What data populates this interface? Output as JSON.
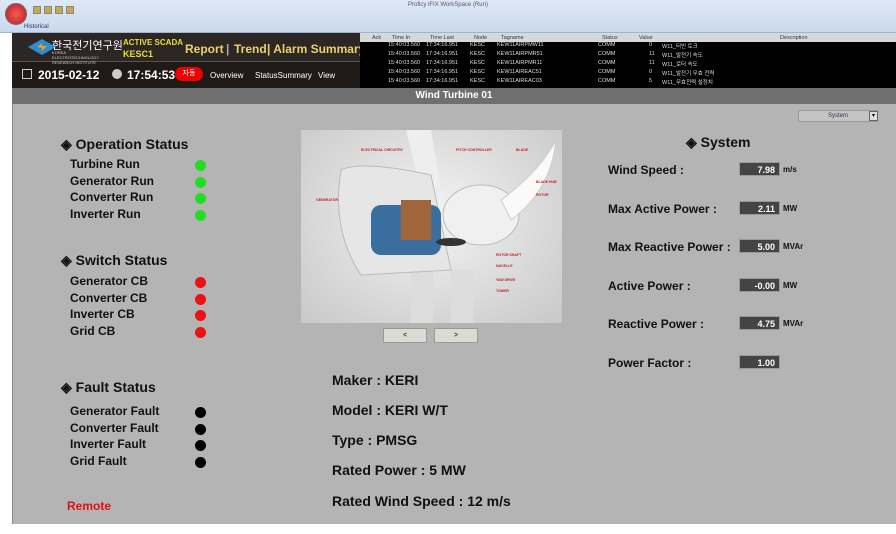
{
  "window": {
    "title": "Proficy iFIX WorkSpace (Run)",
    "ribbon_tab": "Historical"
  },
  "header": {
    "org_korean": "한국전기연구원",
    "org_english": "KOREA ELECTROTECHNOLOGY RESEARCH INSTITUTE",
    "system": "ACTIVE SCADA",
    "station": "KESC1",
    "nav": [
      "Report",
      "|",
      "Trend",
      "| Alarm Summary"
    ],
    "date": "2015-02-12",
    "time": "17:54:53",
    "mode_badge": "자동",
    "subnav": [
      "Overview",
      "StatusSummary",
      "View"
    ]
  },
  "alarms": {
    "columns": [
      "Ack",
      "Time In",
      "Time Last",
      "Node",
      "Tagname",
      "Status",
      "Value",
      "Description"
    ],
    "rows": [
      [
        "",
        "15:40:03.560",
        "17:34:16.951",
        "KESC",
        "KEW11AIRPMW11",
        "COMM",
        "0",
        "W11_터빈 토크"
      ],
      [
        "",
        "15:40:03.560",
        "17:34:16.951",
        "KESC",
        "KEW11AIRPMR51",
        "COMM",
        "11",
        "W11_발전기 속도"
      ],
      [
        "",
        "15:40:03.560",
        "17:34:16.951",
        "KESC",
        "KEW11AIRPMR11",
        "COMM",
        "11",
        "W11_로터 속도"
      ],
      [
        "",
        "15:40:03.560",
        "17:34:16.951",
        "KESC",
        "KEW11AIREAC51",
        "COMM",
        "0",
        "W11_발전기 무효 전력"
      ],
      [
        "",
        "15:40:03.560",
        "17:34:16.951",
        "KESC",
        "KEW11AIREAC03",
        "COMM",
        "5",
        "W11_무효전력 설정치"
      ]
    ]
  },
  "page_title": "Wind Turbine 01",
  "operation": {
    "title": "◈ Operation Status",
    "items": [
      {
        "label": "Turbine Run",
        "color": "#22dd22"
      },
      {
        "label": "Generator Run",
        "color": "#22dd22"
      },
      {
        "label": "Converter Run",
        "color": "#22dd22"
      },
      {
        "label": "Inverter Run",
        "color": "#22dd22"
      }
    ]
  },
  "switch": {
    "title": "◈ Switch Status",
    "items": [
      {
        "label": "Generator CB",
        "color": "#ee1111"
      },
      {
        "label": "Converter CB",
        "color": "#ee1111"
      },
      {
        "label": "Inverter CB",
        "color": "#ee1111"
      },
      {
        "label": "Grid CB",
        "color": "#ee1111"
      }
    ]
  },
  "fault": {
    "title": "◈ Fault Status",
    "items": [
      {
        "label": "Generator Fault",
        "color": "#000000"
      },
      {
        "label": "Converter Fault",
        "color": "#000000"
      },
      {
        "label": "Inverter Fault",
        "color": "#000000"
      },
      {
        "label": "Grid Fault",
        "color": "#000000"
      }
    ]
  },
  "control_mode": "Remote",
  "turbine_image": {
    "labels": [
      "ELECTRICAL CIRCUITRY",
      "PITCH CONTROLLER",
      "BLADE",
      "BLADE HUB",
      "ROTOR",
      "GENERATOR",
      "ROTOR SHAFT",
      "NACELLE",
      "YAW DRIVE",
      "TOWER"
    ],
    "prev": "<",
    "next": ">"
  },
  "specs": [
    "Maker :  KERI",
    "Model :  KERI W/T",
    "Type :   PMSG",
    "Rated Power :  5 MW",
    "Rated Wind Speed :  12 m/s"
  ],
  "system": {
    "dropdown": "System",
    "title": "◈ System",
    "rows": [
      {
        "label": "Wind Speed :",
        "value": "7.98",
        "unit": "m/s"
      },
      {
        "label": "Max Active Power :",
        "value": "2.11",
        "unit": "MW"
      },
      {
        "label": "Max Reactive Power :",
        "value": "5.00",
        "unit": "MVAr"
      },
      {
        "label": "Active Power :",
        "value": "-0.00",
        "unit": "MW"
      },
      {
        "label": "Reactive Power :",
        "value": "4.75",
        "unit": "MVAr"
      },
      {
        "label": "Power Factor :",
        "value": "1.00",
        "unit": ""
      }
    ]
  }
}
